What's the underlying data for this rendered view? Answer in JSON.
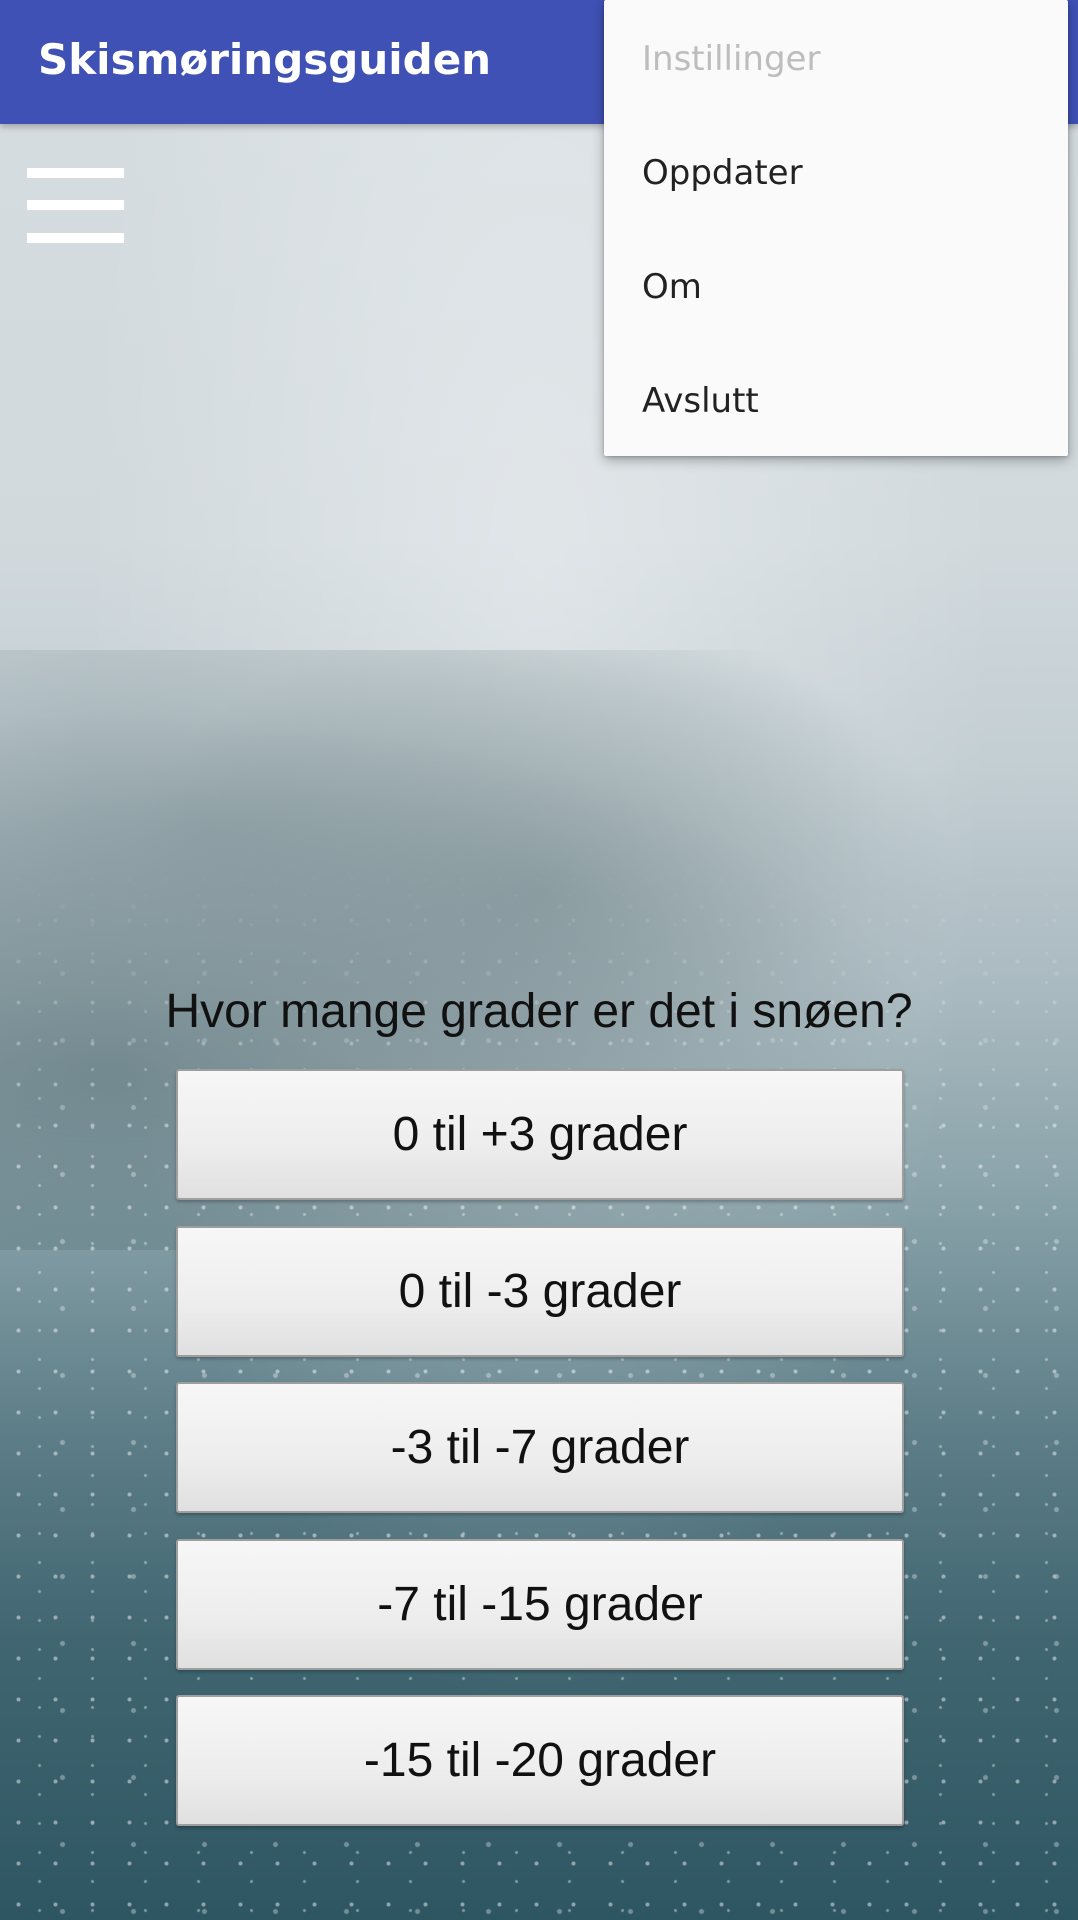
{
  "app": {
    "title": "Skismøringsguiden",
    "accent_color": "#3f51b5"
  },
  "menu_button": {
    "icon": "hamburger-menu-icon"
  },
  "overflow_menu": {
    "items": [
      {
        "label": "Instillinger",
        "enabled": false
      },
      {
        "label": "Oppdater",
        "enabled": true
      },
      {
        "label": "Om",
        "enabled": true
      },
      {
        "label": "Avslutt",
        "enabled": true
      }
    ]
  },
  "main": {
    "question": "Hvor mange grader er det i snøen?",
    "options": [
      {
        "label": "0 til +3 grader"
      },
      {
        "label": "0 til -3 grader"
      },
      {
        "label": "-3 til -7 grader"
      },
      {
        "label": "-7 til -15 grader"
      },
      {
        "label": "-15 til -20 grader"
      }
    ]
  }
}
